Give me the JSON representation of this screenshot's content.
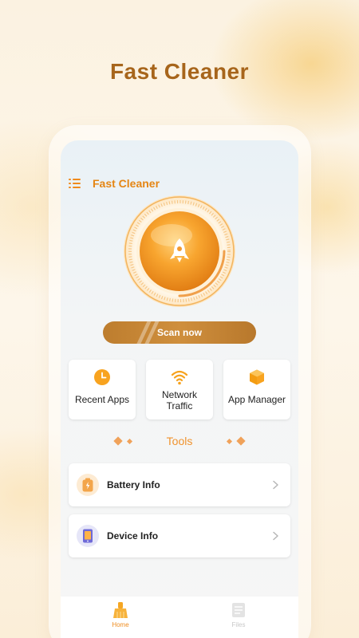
{
  "hero": {
    "title": "Fast Cleaner"
  },
  "app": {
    "title": "Fast Cleaner",
    "scan_label": "Scan now"
  },
  "quick_actions": [
    {
      "label": "Recent Apps",
      "icon": "clock-icon"
    },
    {
      "label": "Network Traffic",
      "icon": "wifi-icon"
    },
    {
      "label": "App Manager",
      "icon": "box-icon"
    }
  ],
  "tools": {
    "heading": "Tools",
    "items": [
      {
        "label": "Battery Info",
        "icon": "battery-icon"
      },
      {
        "label": "Device Info",
        "icon": "phone-icon"
      }
    ]
  },
  "bottom_nav": [
    {
      "label": "Home",
      "icon": "broom-icon",
      "active": true
    },
    {
      "label": "Files",
      "icon": "files-icon",
      "active": false
    }
  ],
  "colors": {
    "accent": "#f08a1c",
    "brand_brown": "#a7651b",
    "scan_button": "#c4843a"
  }
}
